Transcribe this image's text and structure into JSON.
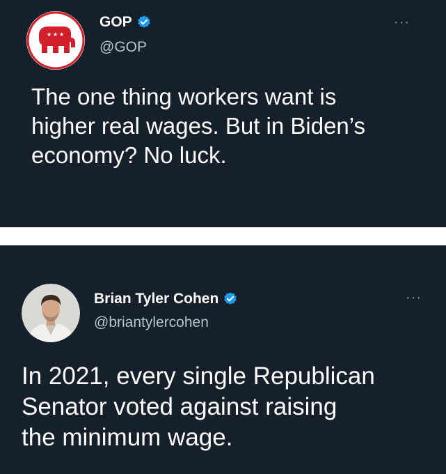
{
  "colors": {
    "background": "#15202b",
    "separator": "#ffffff",
    "text_primary": "#ffffff",
    "text_secondary": "#b8c2cc",
    "verified_badge": "#1d9bf0",
    "gop_red": "#d11f2b"
  },
  "tweets": [
    {
      "author": {
        "display_name": "GOP",
        "handle": "@GOP",
        "verified": true,
        "avatar_icon": "republican-elephant-logo-icon"
      },
      "more_label": "···",
      "text": "The one thing workers want is\nhigher real wages. But in Biden’s\neconomy? No luck."
    },
    {
      "author": {
        "display_name": "Brian Tyler Cohen",
        "handle": "@briantylercohen",
        "verified": true,
        "avatar_icon": "profile-photo"
      },
      "more_label": "···",
      "text": "In 2021, every single Republican\nSenator voted against raising\nthe minimum wage."
    }
  ]
}
